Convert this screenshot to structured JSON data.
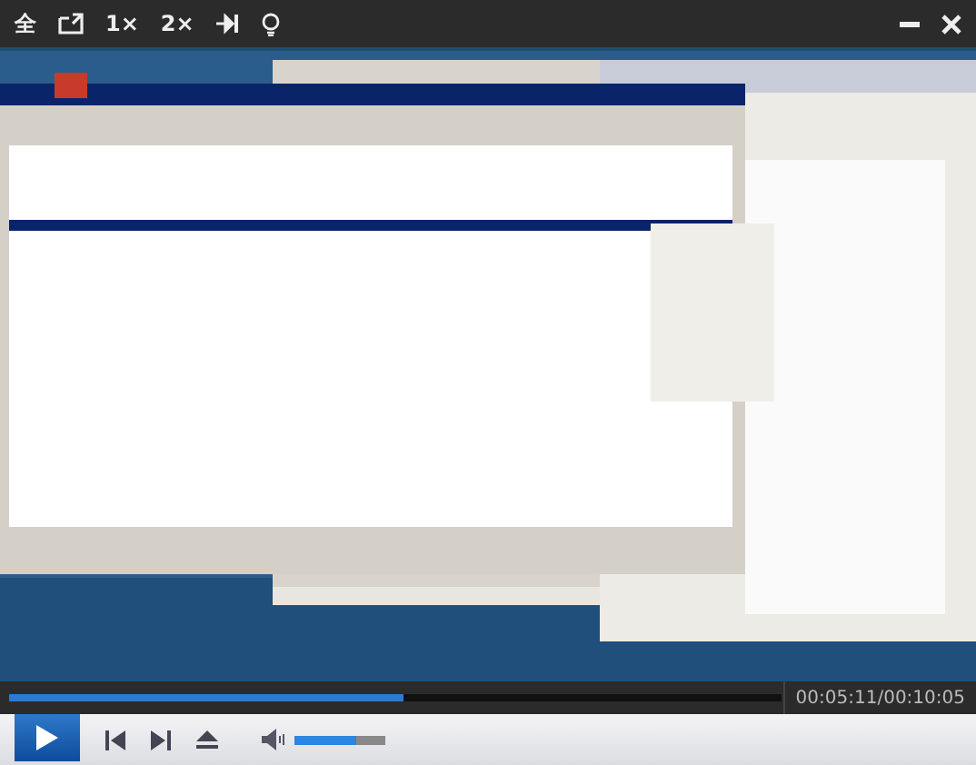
{
  "top_bar": {
    "buttons": [
      "全",
      "1×",
      "2×"
    ]
  },
  "progress": {
    "level": 0.51,
    "time": "00:05:11/00:10:05"
  },
  "volume": {
    "level": 0.67
  }
}
